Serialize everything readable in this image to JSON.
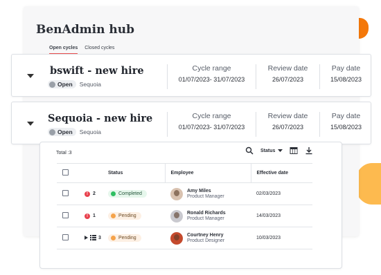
{
  "colors": {
    "accent_orange": "#f4780a",
    "accent_yellow": "#fdba4f",
    "tab_underline": "#ea4d4d"
  },
  "hub": {
    "title": "BenAdmin hub"
  },
  "tabs": [
    {
      "label": "Open cycles",
      "active": true
    },
    {
      "label": "Closed cycles",
      "active": false
    }
  ],
  "cycles": [
    {
      "name": "bswift - new hire",
      "status": "Open",
      "org": "Sequoia",
      "cycle_range_label": "Cycle range",
      "cycle_range": "01/07/2023- 31/07/2023",
      "review_date_label": "Review date",
      "review_date": "26/07/2023",
      "pay_date_label": "Pay date",
      "pay_date": "15/08/2023"
    },
    {
      "name": "Sequoia - new hire",
      "status": "Open",
      "org": "Sequoia",
      "cycle_range_label": "Cycle range",
      "cycle_range": "01/07/2023- 31/07/2023",
      "review_date_label": "Review date",
      "review_date": "26/07/2023",
      "pay_date_label": "Pay date",
      "pay_date": "15/08/2023"
    }
  ],
  "table": {
    "total": "Total :3",
    "status_filter": "Status",
    "headers": {
      "status": "Status",
      "employee": "Employee",
      "effective_date": "Effective date"
    },
    "rows": [
      {
        "count": "2",
        "status": "Completed",
        "name": "Amy Miles",
        "role": "Product Manager",
        "date": "02/03/2023"
      },
      {
        "count": "1",
        "status": "Pending",
        "name": "Ronald Richards",
        "role": "Product Manager",
        "date": "14/03/2023"
      },
      {
        "count": "3",
        "status": "Pending",
        "name": "Courtney Henry",
        "role": "Product Designer",
        "date": "10/03/2023"
      }
    ]
  }
}
